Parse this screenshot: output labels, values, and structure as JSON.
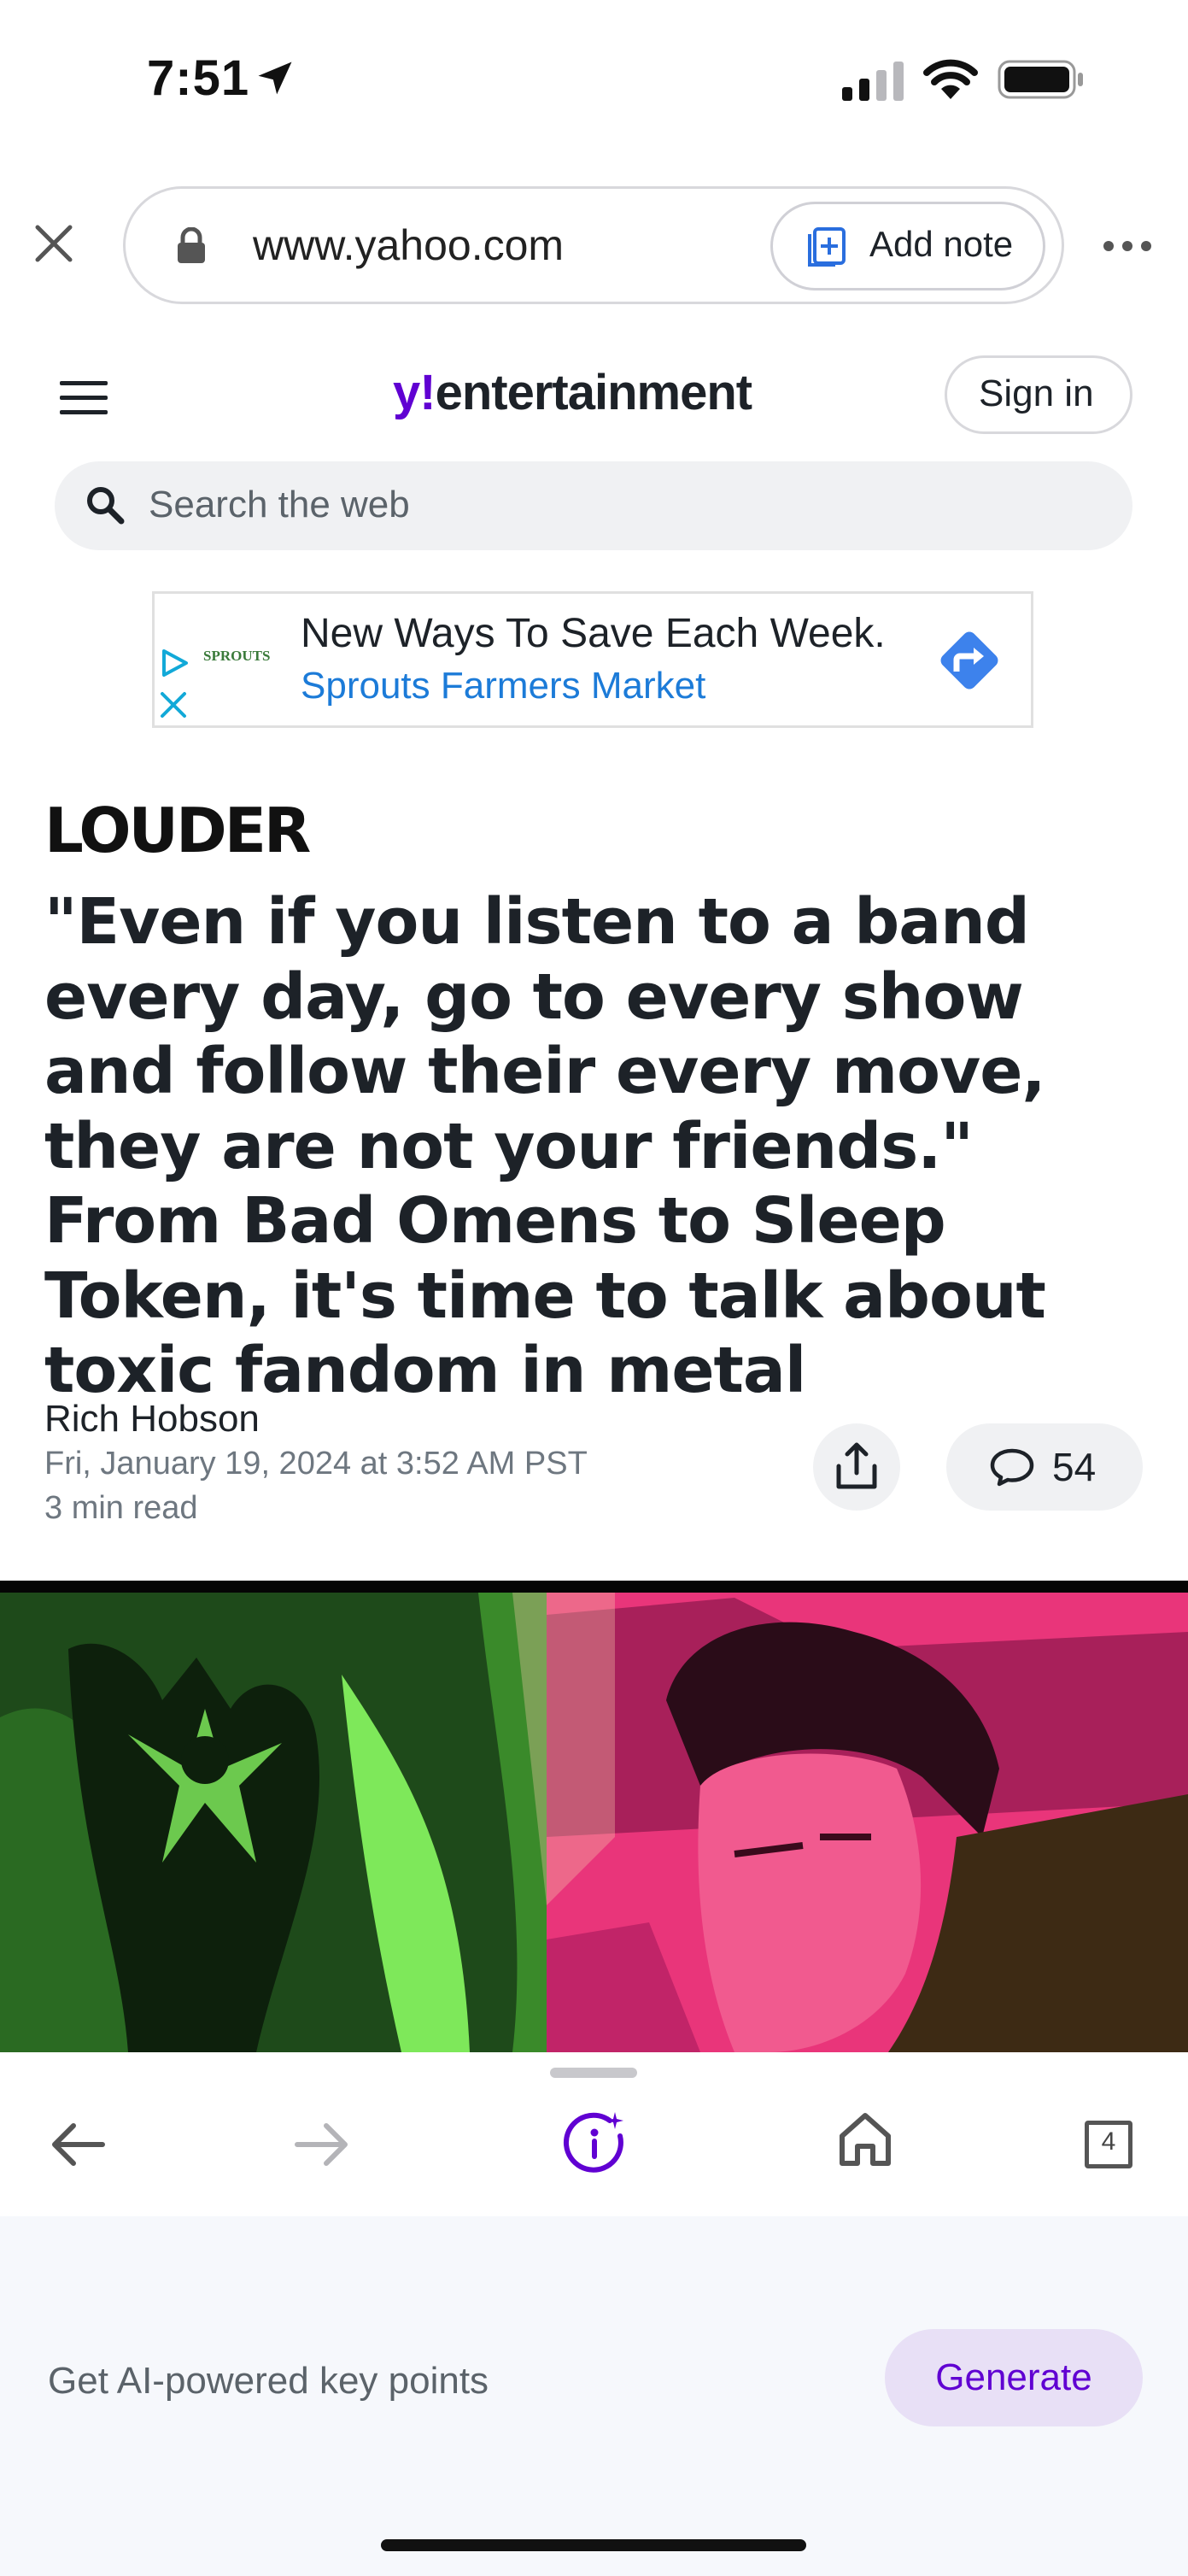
{
  "status_bar": {
    "time": "7:51"
  },
  "browser": {
    "url": "www.yahoo.com",
    "add_note_label": "Add note",
    "tabs_count": "4"
  },
  "site": {
    "logo_y": "y!",
    "logo_text": "entertainment",
    "signin_label": "Sign in",
    "search_placeholder": "Search the web"
  },
  "ad": {
    "brand_logo": "SPROUTS",
    "headline": "New Ways To Save Each Week.",
    "advertiser": "Sprouts Farmers Market"
  },
  "article": {
    "source": "LOUDER",
    "headline": "\"Even if you listen to a band every day, go to every show and follow their every move, they are not your friends.\" From Bad Omens to Sleep Token, it's time to talk about toxic fandom in metal",
    "author": "Rich Hobson",
    "date": "Fri, January 19, 2024 at 3:52 AM PST",
    "read_time": "3 min read",
    "comment_count": "54"
  },
  "ai_panel": {
    "label": "Get AI-powered key points",
    "button": "Generate"
  },
  "colors": {
    "brand": "#6001d2",
    "link": "#1c7bd8",
    "hero_green": "#7ee85a",
    "hero_pink": "#e9357a"
  }
}
